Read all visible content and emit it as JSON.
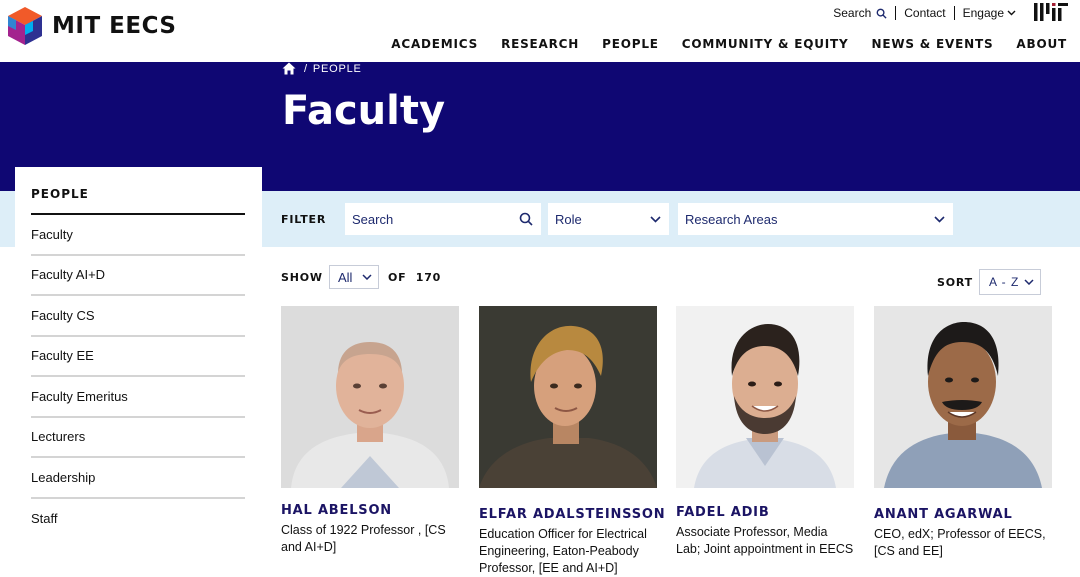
{
  "header": {
    "logo_text": "MIT EECS",
    "utility": {
      "search_label": "Search",
      "contact_label": "Contact",
      "engage_label": "Engage"
    },
    "nav": [
      "ACADEMICS",
      "RESEARCH",
      "PEOPLE",
      "COMMUNITY & EQUITY",
      "NEWS & EVENTS",
      "ABOUT"
    ]
  },
  "hero": {
    "breadcrumb_current": "PEOPLE",
    "title": "Faculty"
  },
  "filters": {
    "label": "FILTER",
    "search_placeholder": "Search",
    "role_label": "Role",
    "research_label": "Research Areas"
  },
  "sidebar": {
    "heading": "PEOPLE",
    "items": [
      "Faculty",
      "Faculty AI+D",
      "Faculty CS",
      "Faculty EE",
      "Faculty Emeritus",
      "Lecturers",
      "Leadership",
      "Staff"
    ]
  },
  "results": {
    "show_label": "SHOW",
    "show_value": "All",
    "of_label": "OF",
    "total": "170",
    "sort_label": "SORT",
    "sort_value": "A - Z"
  },
  "people": [
    {
      "name": "HAL ABELSON",
      "role": "Class of 1922 Professor , [CS and AI+D]"
    },
    {
      "name": "ELFAR ADALSTEINSSON",
      "role": "Education Officer for Electrical Engineering, Eaton-Peabody Professor, [EE and AI+D]"
    },
    {
      "name": "FADEL ADIB",
      "role": "Associate Professor, Media Lab; Joint appointment in EECS"
    },
    {
      "name": "ANANT AGARWAL",
      "role": "CEO, edX; Professor of EECS, [CS and EE]"
    }
  ],
  "colors": {
    "hero_bg": "#0f0773",
    "filter_bg": "#ddeef8",
    "name_color": "#1b1464",
    "logo_colors": [
      "#f15a29",
      "#a3238e",
      "#2e3192",
      "#00aeef"
    ]
  },
  "icons": {
    "home": "home-icon",
    "search": "search-icon",
    "chevron": "chevron-down-icon",
    "mit": "mit-logo-icon"
  }
}
